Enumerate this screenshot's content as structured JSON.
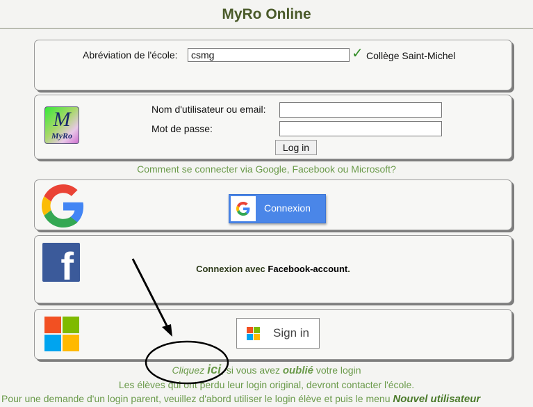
{
  "header": {
    "title": "MyRo Online"
  },
  "school": {
    "label": "Abréviation de l'école:",
    "value": "csmg",
    "school_name": "Collège Saint-Michel"
  },
  "login": {
    "logo_big": "M",
    "logo_small": "MyRo",
    "username_label": "Nom d'utilisateur ou email:",
    "password_label": "Mot de passe:",
    "username_value": "",
    "password_value": "",
    "button": "Log in"
  },
  "social_help": "Comment se connecter via Google, Facebook ou Microsoft?",
  "google": {
    "button": "Connexion"
  },
  "facebook": {
    "text": "Connexion avec ",
    "account": "Facebook-account",
    "suffix": "."
  },
  "microsoft": {
    "button": "Sign in"
  },
  "footer": {
    "forgot_part1": "Cliquez ",
    "forgot_ici": "ici",
    "forgot_part2": ", si vous avez ",
    "forgot_oublie": "oublié",
    "forgot_part3": " votre login",
    "students_line": "Les élèves qui ont perdu leur login original, devront contacter l'école.",
    "parent_part1": "Pour une demande d'un login parent, veuillez d'abord utiliser le login élève et puis le menu ",
    "parent_nouvel": "Nouvel utilisateur"
  },
  "colors": {
    "title": "#4a5a2a",
    "green_text": "#6a9a4a",
    "google_blue": "#4a86e8",
    "facebook_blue": "#3b5a9a",
    "check_green": "#2d8a22"
  }
}
